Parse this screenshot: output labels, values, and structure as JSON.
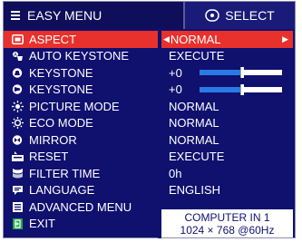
{
  "header": {
    "title": "EASY MENU",
    "select_label": "SELECT"
  },
  "menu": [
    {
      "label": "ASPECT",
      "value": "NORMAL",
      "icon": "aspect-icon",
      "selected": true
    },
    {
      "label": "AUTO KEYSTONE",
      "value": "EXECUTE",
      "icon": "auto-keystone-icon"
    },
    {
      "label": "KEYSTONE",
      "value": "+0",
      "icon": "keystone-v-icon",
      "slider": 0.5
    },
    {
      "label": "KEYSTONE",
      "value": "+0",
      "icon": "keystone-h-icon",
      "slider": 0.5
    },
    {
      "label": "PICTURE MODE",
      "value": "NORMAL",
      "icon": "picture-mode-icon"
    },
    {
      "label": "ECO MODE",
      "value": "NORMAL",
      "icon": "eco-mode-icon"
    },
    {
      "label": "MIRROR",
      "value": "NORMAL",
      "icon": "mirror-icon"
    },
    {
      "label": "RESET",
      "value": "EXECUTE",
      "icon": "reset-icon"
    },
    {
      "label": "FILTER TIME",
      "value": "0h",
      "icon": "filter-time-icon"
    },
    {
      "label": "LANGUAGE",
      "value": "ENGLISH",
      "icon": "language-icon"
    },
    {
      "label": "ADVANCED MENU",
      "value": "",
      "icon": "advanced-menu-icon"
    },
    {
      "label": "EXIT",
      "value": "",
      "icon": "exit-icon"
    }
  ],
  "info": {
    "input": "COMPUTER IN 1",
    "signal": "1024 × 768 @60Hz"
  },
  "colors": {
    "background": "#10106f",
    "highlight": "#e8312c",
    "slider_fill": "#2a7ae4"
  }
}
